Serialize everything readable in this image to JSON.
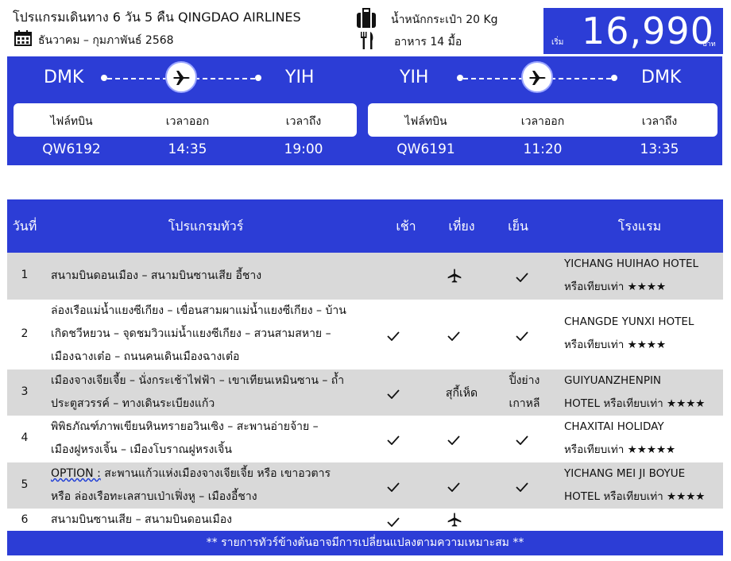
{
  "header": {
    "title": "โปรแกรมเดินทาง 6 วัน 5 คืน QINGDAO AIRLINES",
    "dates": "ธันวาคม – กุมภาพันธ์ 2568",
    "baggage": "น้ำหนักกระเป๋า 20 Kg",
    "meals": "อาหาร 14 มื้อ",
    "price_prefix": "เริ่ม",
    "price": "16,990",
    "price_unit": "บาท"
  },
  "flights": [
    {
      "from": "DMK",
      "to": "YIH",
      "label_flight": "ไฟล์ทบิน",
      "label_depart": "เวลาออก",
      "label_arrive": "เวลาถึง",
      "flight_no": "QW6192",
      "depart": "14:35",
      "arrive": "19:00"
    },
    {
      "from": "YIH",
      "to": "DMK",
      "label_flight": "ไฟล์ทบิน",
      "label_depart": "เวลาออก",
      "label_arrive": "เวลาถึง",
      "flight_no": "QW6191",
      "depart": "11:20",
      "arrive": "13:35"
    }
  ],
  "table": {
    "headers": {
      "day": "วันที่",
      "program": "โปรแกรมทัวร์",
      "breakfast": "เช้า",
      "lunch": "เที่ยง",
      "dinner": "เย็น",
      "hotel": "โรงแรม"
    },
    "rows": [
      {
        "day": "1",
        "program": [
          "สนามบินดอนเมือง – สนามบินซานเสีย อี้ชาง"
        ],
        "breakfast": "",
        "lunch": "plane-icon",
        "dinner": "check-icon",
        "hotel": [
          "YICHANG HUIHAO HOTEL",
          "หรือเทียบเท่า ★★★★"
        ]
      },
      {
        "day": "2",
        "program": [
          "ล่องเรือแม่น้ำแยงซีเกียง – เขื่อนสามผาแม่น้ำแยงซีเกียง – บ้าน",
          "เกิดชวีหยวน – จุดชมวิวแม่น้ำแยงซีเกียง – สวนสามสหาย –",
          "เมืองฉางเต๋อ – ถนนคนเดินเมืองฉางเต๋อ"
        ],
        "breakfast": "check-icon",
        "lunch": "check-icon",
        "dinner": "check-icon",
        "hotel": [
          "CHANGDE YUNXI HOTEL",
          "หรือเทียบเท่า ★★★★"
        ]
      },
      {
        "day": "3",
        "program": [
          "เมืองจางเจียเจี้ย – นั่งกระเช้าไฟฟ้า – เขาเทียนเหมินซาน – ถ้ำ",
          "ประตูสวรรค์ – ทางเดินระเบียงแก้ว"
        ],
        "breakfast": "check-icon",
        "lunch": "สุกี้เห็ด",
        "dinner": [
          "ปิ้งย่าง",
          "เกาหลี"
        ],
        "hotel": [
          "GUIYUANZHENPIN",
          "HOTEL หรือเทียบเท่า ★★★★"
        ]
      },
      {
        "day": "4",
        "program": [
          "พิพิธภัณฑ์ภาพเขียนหินทรายอวินเซิง – สะพานอ่ายจ้าย –",
          "เมืองฝูหรงเจิ้น – เมืองโบราณฝูหรงเจิ้น"
        ],
        "breakfast": "check-icon",
        "lunch": "check-icon",
        "dinner": "check-icon",
        "hotel": [
          "CHAXITAI HOLIDAY",
          "หรือเทียบเท่า ★★★★★"
        ]
      },
      {
        "day": "5",
        "program_option": "OPTION :",
        "program": [
          "สะพานแก้วแห่งเมืองจางเจียเจี้ย หรือ เขาอวตาร",
          "หรือ ล่องเรือทะเลสาบเป่าเฟิ่งหู – เมืองอี้ชาง"
        ],
        "breakfast": "check-icon",
        "lunch": "check-icon",
        "dinner": "check-icon",
        "hotel": [
          "YICHANG MEI JI BOYUE",
          "HOTEL หรือเทียบเท่า ★★★★"
        ]
      },
      {
        "day": "6",
        "program": [
          "สนามบินซานเสีย – สนามบินดอนเมือง"
        ],
        "breakfast": "check-icon",
        "lunch": "plane-icon",
        "dinner": "",
        "hotel": []
      }
    ]
  },
  "footer": "** รายการทัวร์ข้างต้นอาจมีการเปลี่ยนแปลงตามความเหมาะสม **"
}
